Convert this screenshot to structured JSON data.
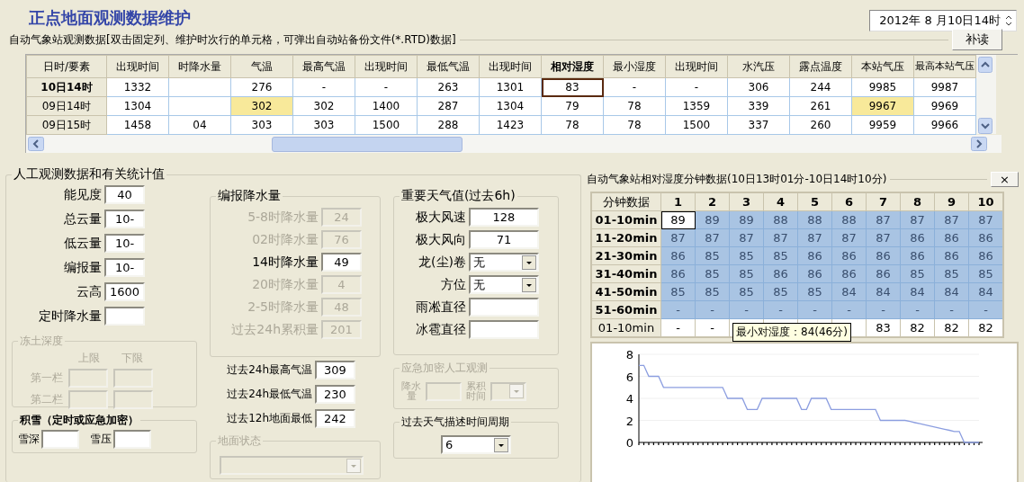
{
  "title": "正点地面观测数据维护",
  "datetime": "2012年 8 月10日14时",
  "auto_station": {
    "caption": "自动气象站观测数据[双击固定列、维护时次行的单元格，可弹出自动站备份文件(*.RTD)数据]",
    "reread_button": "补读",
    "corner": "日时/要素",
    "columns": [
      {
        "label": "出现时间",
        "selected": false
      },
      {
        "label": "时降水量",
        "selected": false
      },
      {
        "label": "气温",
        "selected": false
      },
      {
        "label": "最高气温",
        "selected": false
      },
      {
        "label": "出现时间",
        "selected": false
      },
      {
        "label": "最低气温",
        "selected": false
      },
      {
        "label": "出现时间",
        "selected": false
      },
      {
        "label": "相对湿度",
        "selected": true
      },
      {
        "label": "最小湿度",
        "selected": false
      },
      {
        "label": "出现时间",
        "selected": false
      },
      {
        "label": "水汽压",
        "selected": false
      },
      {
        "label": "露点温度",
        "selected": false
      },
      {
        "label": "本站气压",
        "selected": false
      },
      {
        "label": "最高本站气压",
        "selected": false
      }
    ],
    "rows": [
      {
        "label": "10日14时",
        "current": true,
        "cells": [
          {
            "text": "1332",
            "highlighted": false
          },
          {
            "highlighted": false
          },
          {
            "text": "276",
            "highlighted": false
          },
          {
            "text": "-",
            "highlighted": false
          },
          {
            "text": "-",
            "highlighted": false
          },
          {
            "text": "263",
            "highlighted": false
          },
          {
            "text": "1301",
            "highlighted": false
          },
          {
            "text": "83",
            "highlighted": false
          },
          {
            "text": "-",
            "highlighted": false
          },
          {
            "text": "-",
            "highlighted": false
          },
          {
            "text": "306",
            "highlighted": false
          },
          {
            "text": "244",
            "highlighted": false
          },
          {
            "text": "9985",
            "highlighted": false
          },
          {
            "text": "9987",
            "highlighted": false
          }
        ]
      },
      {
        "label": "09日14时",
        "current": false,
        "cells": [
          {
            "text": "1304",
            "highlighted": false
          },
          {
            "highlighted": false
          },
          {
            "text": "302",
            "highlighted": true
          },
          {
            "text": "302",
            "highlighted": false
          },
          {
            "text": "1400",
            "highlighted": false
          },
          {
            "text": "287",
            "highlighted": false
          },
          {
            "text": "1304",
            "highlighted": false
          },
          {
            "text": "79",
            "highlighted": false
          },
          {
            "text": "78",
            "highlighted": false
          },
          {
            "text": "1359",
            "highlighted": false
          },
          {
            "text": "339",
            "highlighted": false
          },
          {
            "text": "261",
            "highlighted": false
          },
          {
            "text": "9967",
            "highlighted": true
          },
          {
            "text": "9969",
            "highlighted": false
          }
        ]
      },
      {
        "label": "09日15时",
        "current": false,
        "cells": [
          {
            "text": "1458",
            "highlighted": false
          },
          {
            "text": "04",
            "highlighted": false
          },
          {
            "text": "303",
            "highlighted": false
          },
          {
            "text": "303",
            "highlighted": false
          },
          {
            "text": "1500",
            "highlighted": false
          },
          {
            "text": "288",
            "highlighted": false
          },
          {
            "text": "1423",
            "highlighted": false
          },
          {
            "text": "78",
            "highlighted": false
          },
          {
            "text": "78",
            "highlighted": false
          },
          {
            "text": "1500",
            "highlighted": false
          },
          {
            "text": "337",
            "highlighted": false
          },
          {
            "text": "260",
            "highlighted": false
          },
          {
            "text": "9959",
            "highlighted": false
          },
          {
            "text": "9966",
            "highlighted": false
          }
        ]
      }
    ]
  },
  "manual": {
    "title": "人工观测数据和有关统计值",
    "fields": [
      {
        "label": "能见度",
        "value": "40"
      },
      {
        "label": "总云量",
        "value": "10-"
      },
      {
        "label": "低云量",
        "value": "10-"
      },
      {
        "label": "编报量",
        "value": "10-"
      },
      {
        "label": "云高",
        "value": "1600"
      },
      {
        "label": "定时降水量"
      }
    ],
    "frozen_soil": {
      "title": "冻土深度",
      "disabled": true,
      "columns": [
        "上限",
        "下限"
      ],
      "rows": [
        "第一栏",
        "第二栏"
      ]
    },
    "snow": {
      "title": "积雪（定时或应急加密）",
      "fields": [
        "雪深",
        "雪压"
      ]
    },
    "precip": {
      "title": "编报降水量",
      "fields": [
        {
          "label": "5-8时降水量",
          "value": "24",
          "disabled": true
        },
        {
          "label": "02时降水量",
          "value": "76",
          "disabled": true
        },
        {
          "label": "14时降水量",
          "value": "49",
          "disabled": false
        },
        {
          "label": "20时降水量",
          "value": "4",
          "disabled": true
        },
        {
          "label": "2-5时降水量",
          "value": "48",
          "disabled": true
        },
        {
          "label": "过去24h累积量",
          "value": "201",
          "disabled": true
        }
      ]
    },
    "extremes": [
      {
        "label": "过去24h最高气温",
        "value": "309"
      },
      {
        "label": "过去24h最低气温",
        "value": "230"
      },
      {
        "label": "过去12h地面最低",
        "value": "242"
      }
    ],
    "ground_state": {
      "title": "地面状态",
      "disabled": true
    },
    "weather": {
      "title": "重要天气值(过去6h)",
      "fields": [
        {
          "kind": "input",
          "label": "极大风速",
          "value": "128"
        },
        {
          "kind": "input",
          "label": "极大风向",
          "value": "71"
        },
        {
          "kind": "select",
          "label": "龙(尘)卷",
          "value": "无"
        },
        {
          "kind": "select",
          "label": "方位",
          "value": "无"
        },
        {
          "kind": "input",
          "label": "雨凇直径"
        },
        {
          "kind": "input",
          "label": "冰雹直径"
        }
      ]
    },
    "emergency": {
      "title": "应急加密人工观测",
      "disabled": true,
      "precip_label": "降水量",
      "period_label": "累积时间"
    },
    "past_weather": {
      "title": "过去天气描述时间周期",
      "value": "6"
    }
  },
  "minute": {
    "title": "自动气象站相对湿度分钟数据(10日13时01分-10日14时10分)",
    "close_button": "×",
    "corner": "分钟数据",
    "columns": [
      "1",
      "2",
      "3",
      "4",
      "5",
      "6",
      "7",
      "8",
      "9",
      "10"
    ],
    "rows": [
      {
        "label": "01-10min",
        "selected": true,
        "anchor": true,
        "values": [
          "89",
          "89",
          "89",
          "88",
          "88",
          "88",
          "87",
          "87",
          "87",
          "87"
        ]
      },
      {
        "label": "11-20min",
        "selected": true,
        "anchor": false,
        "values": [
          "87",
          "87",
          "87",
          "87",
          "87",
          "87",
          "87",
          "86",
          "86",
          "86"
        ]
      },
      {
        "label": "21-30min",
        "selected": true,
        "anchor": false,
        "values": [
          "86",
          "85",
          "85",
          "85",
          "86",
          "86",
          "86",
          "86",
          "86",
          "86"
        ]
      },
      {
        "label": "31-40min",
        "selected": true,
        "anchor": false,
        "values": [
          "86",
          "85",
          "85",
          "86",
          "86",
          "86",
          "86",
          "85",
          "85",
          "85"
        ]
      },
      {
        "label": "41-50min",
        "selected": true,
        "anchor": false,
        "values": [
          "85",
          "85",
          "85",
          "85",
          "85",
          "84",
          "84",
          "84",
          "84",
          "84"
        ]
      },
      {
        "label": "51-60min",
        "selected": true,
        "anchor": false,
        "values": [
          "-",
          "-",
          "-",
          "-",
          "-",
          "-",
          "-",
          "-",
          "-",
          "-"
        ]
      },
      {
        "label": "01-10min",
        "selected": false,
        "anchor": false,
        "cells": [
          {
            "text": "-"
          },
          {
            "text": "-"
          },
          {},
          {},
          {},
          {},
          {
            "text": "83"
          },
          {
            "text": "82"
          },
          {
            "text": "82"
          },
          {
            "text": "82"
          }
        ]
      }
    ],
    "tooltip": "最小对湿度：84(46分)",
    "chart_data": {
      "type": "line",
      "grid": true,
      "ylim": [
        0,
        8
      ],
      "yticks": [
        0,
        2,
        4,
        6,
        8
      ],
      "series": [
        {
          "color": "#8c9ee0",
          "values": [
            7,
            7,
            6,
            6,
            6,
            5,
            5,
            5,
            5,
            5,
            5,
            5,
            5,
            5,
            5,
            5,
            5,
            5,
            4,
            4,
            4,
            4,
            3,
            3,
            3,
            4,
            4,
            4,
            4,
            4,
            4,
            4,
            4,
            3,
            3,
            4,
            4,
            4,
            4,
            3,
            3,
            3,
            3,
            3,
            3,
            3,
            3,
            3,
            3,
            2,
            2,
            2,
            2,
            2,
            2,
            1.9,
            1.8,
            1.7,
            1.6,
            1.5,
            1.4,
            1.3,
            1.2,
            1.1,
            1,
            1,
            0,
            0,
            0,
            0
          ]
        }
      ]
    }
  }
}
